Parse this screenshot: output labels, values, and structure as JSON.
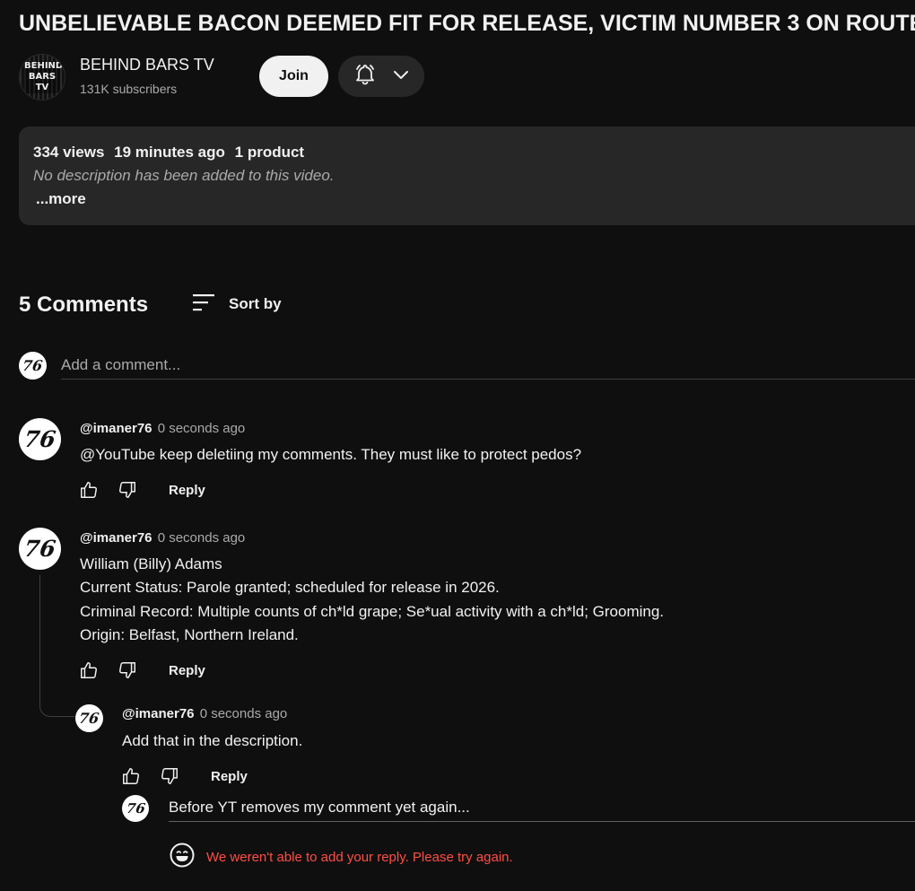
{
  "video": {
    "title": "UNBELIEVABLE BACON DEEMED FIT FOR RELEASE, VICTIM NUMBER 3 ON ROUTE"
  },
  "channel": {
    "avatar_text": "BEHIND BARS TV",
    "name": "BEHIND BARS TV",
    "subscribers": "131K subscribers",
    "join_label": "Join",
    "bell_icon": "bell-icon",
    "chevron_icon": "chevron-down-icon"
  },
  "description": {
    "views": "334 views",
    "age": "19 minutes ago",
    "products": "1 product",
    "text": "No description has been added to this video.",
    "more_label": "...more"
  },
  "comments_section": {
    "count_label": "5 Comments",
    "sort_label": "Sort by",
    "add_placeholder": "Add a comment...",
    "user_avatar": "76"
  },
  "comments": [
    {
      "handle": "@imaner76",
      "time": "0 seconds ago",
      "avatar": "76",
      "lines": [
        "@YouTube keep deletiing my comments. They must like to protect pedos?"
      ],
      "reply_label": "Reply"
    },
    {
      "handle": "@imaner76",
      "time": "0 seconds ago",
      "avatar": "76",
      "lines": [
        "William (Billy) Adams",
        "Current Status: Parole granted; scheduled for release in 2026.",
        "Criminal Record: Multiple counts of ch*ld grape; Se*ual activity with a ch*ld; Grooming.",
        "Origin: Belfast, Northern Ireland."
      ],
      "reply_label": "Reply"
    }
  ],
  "reply": {
    "handle": "@imaner76",
    "time": "0 seconds ago",
    "avatar": "76",
    "text": "Add that in the description.",
    "reply_label": "Reply"
  },
  "reply_box": {
    "avatar": "76",
    "value": "Before YT removes my comment yet again...",
    "error_icon": "emoji-icon",
    "error_text": "We weren't able to add your reply. Please try again.",
    "error_color": "#ff4e45"
  }
}
